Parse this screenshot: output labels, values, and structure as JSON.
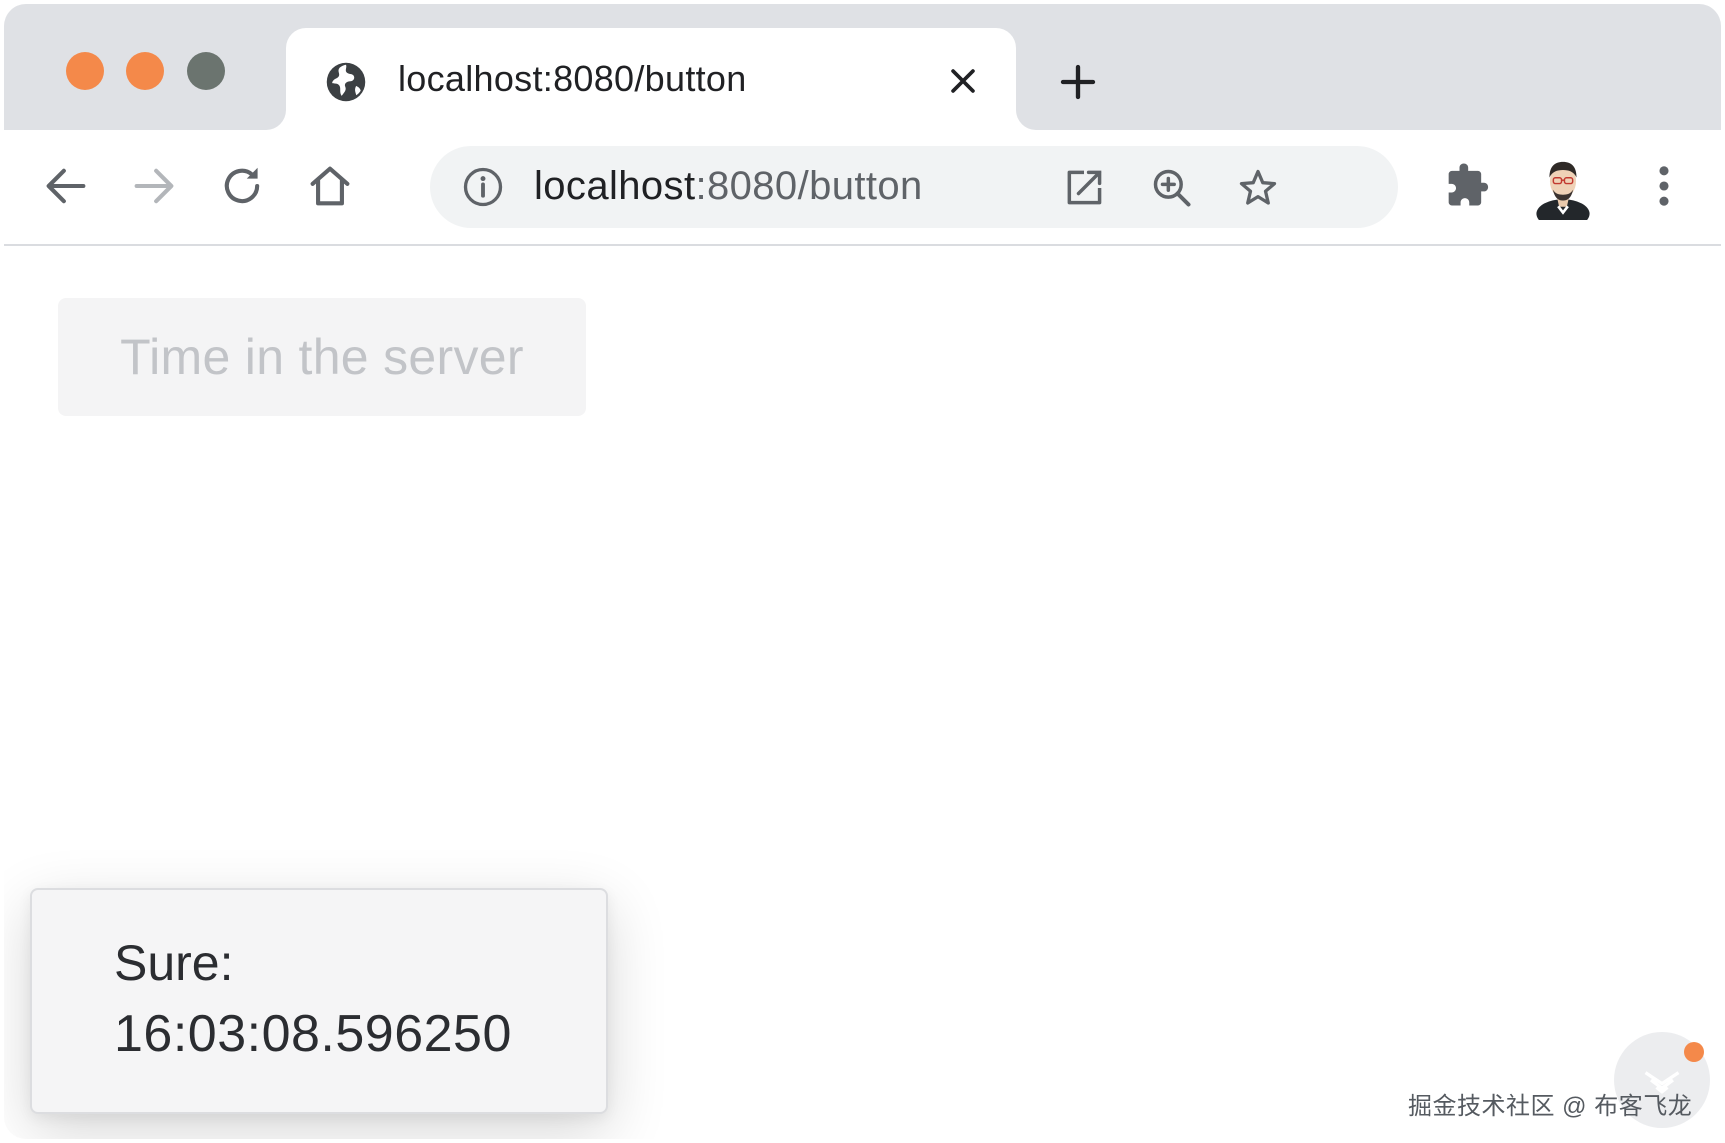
{
  "window": {
    "controls": {
      "close_color": "#f4894a",
      "minimize_color": "#f4894a",
      "maximize_color": "#6b746f"
    }
  },
  "tab": {
    "title": "localhost:8080/button",
    "favicon": "globe-icon",
    "close_icon": "close-icon"
  },
  "new_tab_icon": "plus-icon",
  "toolbar": {
    "back_icon": "back-arrow-icon",
    "forward_icon": "forward-arrow-icon",
    "reload_icon": "reload-icon",
    "home_icon": "home-icon",
    "extensions_icon": "puzzle-piece-icon",
    "profile_icon": "avatar",
    "menu_icon": "kebab-menu-icon"
  },
  "omnibox": {
    "info_icon": "info-icon",
    "url_host": "localhost",
    "url_rest": ":8080/button",
    "open_icon": "open-external-icon",
    "zoom_icon": "zoom-in-icon",
    "bookmark_icon": "star-icon"
  },
  "page": {
    "button_label": "Time in the server",
    "toast": {
      "label": "Sure:",
      "time": "16:03:08.596250"
    }
  },
  "watermark": {
    "text": "掘金技术社区 @ 布客飞龙",
    "accent_color": "#f4894a"
  }
}
